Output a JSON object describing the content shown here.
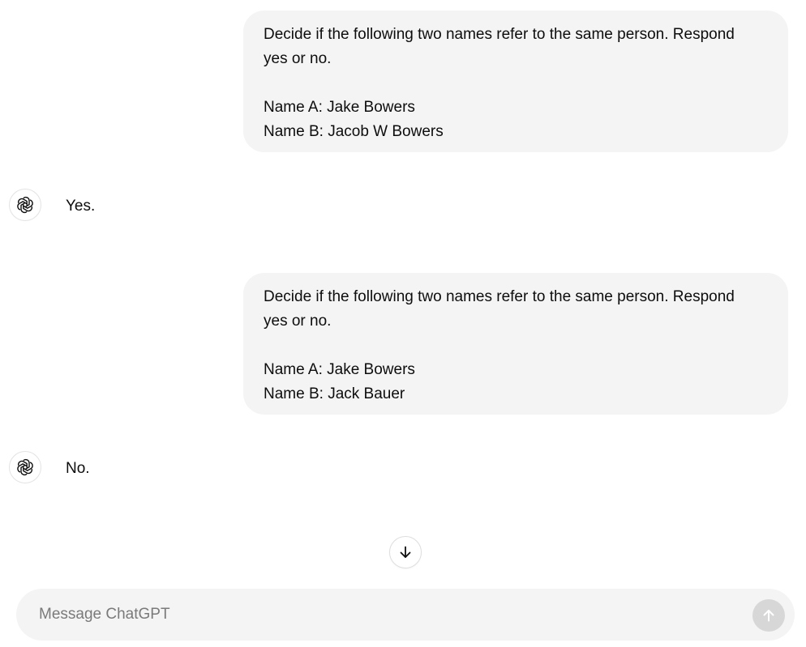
{
  "conversation": {
    "messages": [
      {
        "role": "user",
        "lines": [
          "Decide if the following two names refer to the same person. Respond",
          "yes or no.",
          "",
          "Name A: Jake Bowers",
          "Name B: Jacob W Bowers"
        ]
      },
      {
        "role": "assistant",
        "text": "Yes."
      },
      {
        "role": "user",
        "lines": [
          "Decide if the following two names refer to the same person. Respond",
          "yes or no.",
          "",
          "Name A: Jake Bowers",
          "Name B: Jack Bauer"
        ]
      },
      {
        "role": "assistant",
        "text": "No."
      }
    ]
  },
  "composer": {
    "placeholder": "Message ChatGPT",
    "value": ""
  },
  "icons": {
    "assistant_avatar": "openai-logo-icon",
    "scroll_down": "arrow-down-icon",
    "send": "arrow-up-icon"
  },
  "colors": {
    "user_bubble": "#f4f4f4",
    "composer_bg": "#f4f4f4",
    "send_button_disabled": "#d7d7d7",
    "text": "#0d0d0d"
  }
}
